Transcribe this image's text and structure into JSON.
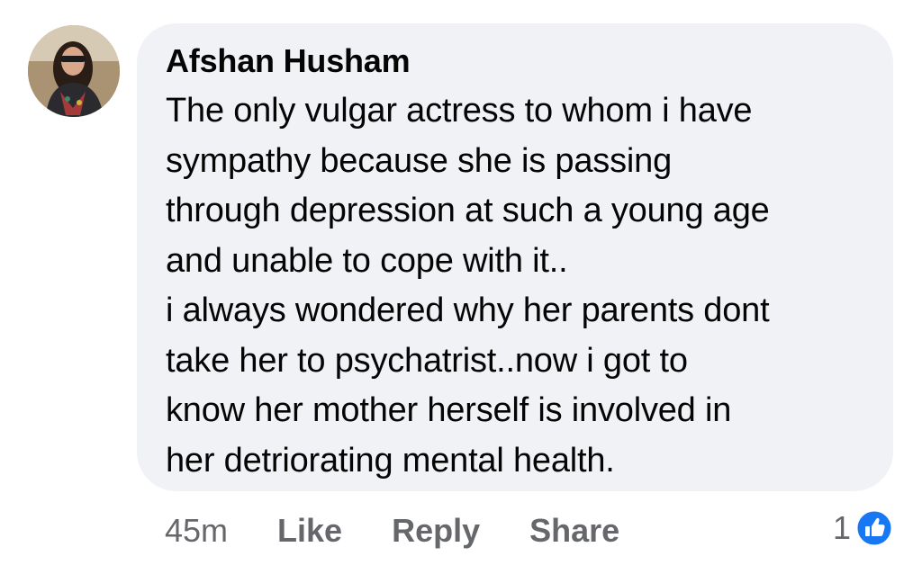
{
  "comment": {
    "author": "Afshan Husham",
    "text_lines": [
      "The only vulgar actress to whom i have",
      "sympathy because she is passing",
      "through depression at such a young age",
      "and unable to cope with it..",
      "i always wondered why her parents dont",
      "take her to psychatrist..now i got to",
      "know her mother herself is involved in",
      "her detriorating mental health."
    ]
  },
  "actions": {
    "time": "45m",
    "like_label": "Like",
    "reply_label": "Reply",
    "share_label": "Share"
  },
  "reactions": {
    "count": "1",
    "icon": "thumbs-up-icon",
    "icon_color": "#1877f2"
  },
  "colors": {
    "bubble_bg": "#f0f2f5",
    "secondary_text": "#65676b",
    "primary_text": "#050505"
  }
}
